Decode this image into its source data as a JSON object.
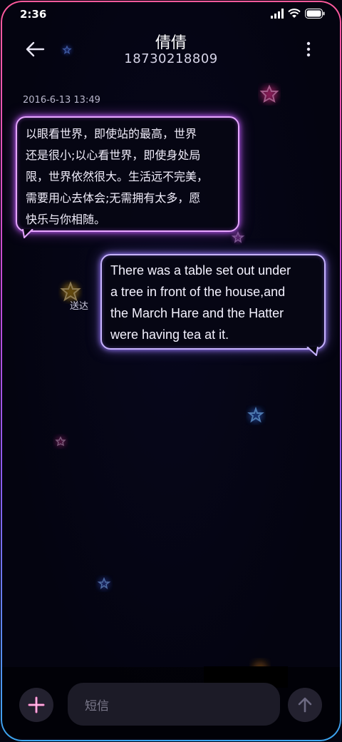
{
  "status_bar": {
    "time": "2:36",
    "icons": [
      "signal-icon",
      "wifi-icon",
      "battery-icon"
    ]
  },
  "header": {
    "contact_name": "倩倩",
    "contact_number": "18730218809",
    "back_icon": "back-arrow-icon",
    "menu_icon": "more-vertical-icon"
  },
  "conversation": {
    "timestamp": "2016-6-13 13:49",
    "messages": [
      {
        "direction": "incoming",
        "lines": [
          "以眼看世界，即使站的最高，世界",
          "还是很小;以心看世界，即使身处局",
          "限，世界依然很大。生活远不完美，",
          "需要用心去体会;无需拥有太多，愿",
          "快乐与你相随。"
        ]
      },
      {
        "direction": "outgoing",
        "status": "送达",
        "lines": [
          "There was a table set out under",
          "a tree in front of the house,and",
          "the March Hare and the Hatter",
          "were having tea at it."
        ]
      }
    ]
  },
  "composer": {
    "placeholder": "短信",
    "add_icon": "plus-icon",
    "send_icon": "send-arrow-icon"
  },
  "colors": {
    "background": "#04040f",
    "incoming_border": "#e6a6ff",
    "outgoing_border": "#c7b3ff",
    "frame_top": "#ff5a9c",
    "frame_bottom": "#3ba7f0"
  }
}
